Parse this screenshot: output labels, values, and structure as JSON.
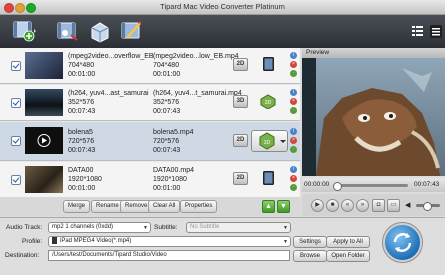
{
  "window": {
    "title": "Tipard Mac Video Converter Platinum"
  },
  "toolbar": {
    "icons": [
      "add-file-icon",
      "edit-video-icon",
      "clip-icon",
      "3d-icon",
      "effect-icon"
    ],
    "view_icons": [
      "list-view-icon",
      "menu-icon"
    ]
  },
  "files": [
    {
      "source_name": "(mpeg2video...overflow_EB",
      "source_res": "704*480",
      "source_time": "00:01:00",
      "output_name": "(mpeg2video...low_EB.mp4",
      "output_res": "704*480",
      "output_time": "00:01:00",
      "mode": "2D",
      "selected": false,
      "thumb_color": "#3a4a66"
    },
    {
      "source_name": "(h264, yuv4...ast_samurai",
      "source_res": "352*576",
      "source_time": "00:07:43",
      "output_name": "(h264, yuv4...t_samurai.mp4",
      "output_res": "352*576",
      "output_time": "00:07:43",
      "mode": "3D",
      "selected": false,
      "thumb_color": "#1b2a3a"
    },
    {
      "source_name": "bolena5",
      "source_res": "720*576",
      "source_time": "00:07:43",
      "output_name": "bolena5.mp4",
      "output_res": "720*576",
      "output_time": "00:07:43",
      "mode": "2D",
      "selected": true,
      "thumb_color": "#0d0d0d"
    },
    {
      "source_name": "DATA00",
      "source_res": "1920*1080",
      "source_time": "00:01:00",
      "output_name": "DATA00.mp4",
      "output_res": "1920*1080",
      "output_time": "00:01:00",
      "mode": "2D",
      "selected": false,
      "thumb_color": "#4a3a2a"
    }
  ],
  "list_ops": {
    "merge": "Merge",
    "rename": "Rename",
    "remove": "Remove",
    "clear_all": "Clear All",
    "properties": "Properties"
  },
  "preview": {
    "label": "Preview",
    "time_current": "00:00:00",
    "time_total": "00:07:43",
    "progress": 0.0
  },
  "settings": {
    "audio_track_label": "Audio Track:",
    "audio_track_value": "mp2 1 channels (0xdd)",
    "subtitle_label": "Subtitle:",
    "subtitle_value": "No Subtitle",
    "profile_label": "Profile:",
    "profile_value": "iPad MPEG4 Video(*.mp4)",
    "settings_button": "Settings",
    "apply_all_button": "Apply to All",
    "destination_label": "Destination:",
    "destination_value": "/Users/test/Documents/Tipard Studio/Video",
    "browse_button": "Browse",
    "open_folder_button": "Open Folder"
  },
  "colors": {
    "toolbar": "#2e3238",
    "selected_row": "#cfd9e6",
    "convert": "#1f6fb8"
  }
}
